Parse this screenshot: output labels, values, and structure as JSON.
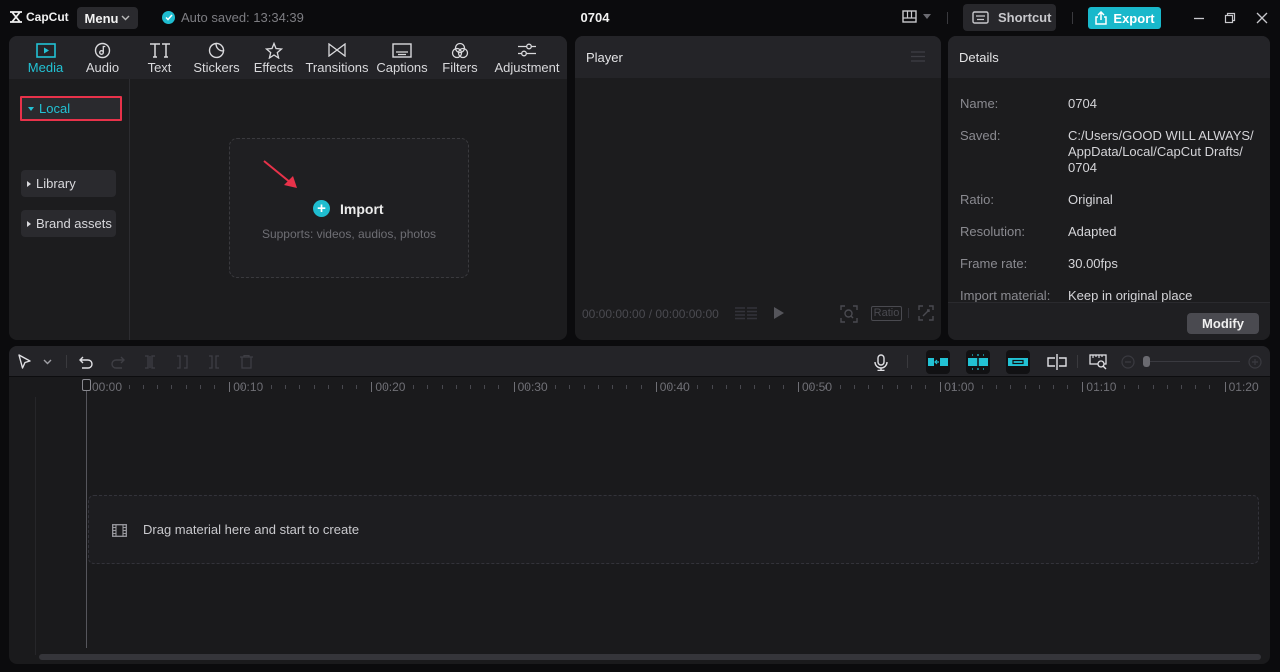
{
  "titlebar": {
    "app_name": "CapCut",
    "menu_label": "Menu",
    "autosave_text": "Auto saved: 13:34:39",
    "project_title": "0704",
    "shortcut_label": "Shortcut",
    "export_label": "Export",
    "accent_color": "#19b8cb"
  },
  "media_tabs": [
    {
      "label": "Media",
      "icon": "media-icon",
      "active": true
    },
    {
      "label": "Audio",
      "icon": "audio-icon",
      "active": false
    },
    {
      "label": "Text",
      "icon": "text-icon",
      "active": false
    },
    {
      "label": "Stickers",
      "icon": "stickers-icon",
      "active": false
    },
    {
      "label": "Effects",
      "icon": "effects-icon",
      "active": false
    },
    {
      "label": "Transitions",
      "icon": "transitions-icon",
      "active": false
    },
    {
      "label": "Captions",
      "icon": "captions-icon",
      "active": false
    },
    {
      "label": "Filters",
      "icon": "filters-icon",
      "active": false
    },
    {
      "label": "Adjustment",
      "icon": "adjustment-icon",
      "active": false
    }
  ],
  "media_sidebar": {
    "local": "Local",
    "import": "Import",
    "library": "Library",
    "brand_assets": "Brand assets"
  },
  "import_box": {
    "title": "Import",
    "subtitle": "Supports: videos, audios, photos"
  },
  "player": {
    "title": "Player",
    "timecode": "00:00:00:00 / 00:00:00:00",
    "ratio_label": "Ratio"
  },
  "details": {
    "title": "Details",
    "rows": [
      {
        "label": "Name:",
        "value": "0704"
      },
      {
        "label": "Saved:",
        "value_lines": [
          "C:/Users/GOOD WILL ALWAYS/",
          "AppData/Local/CapCut Drafts/",
          "0704"
        ]
      },
      {
        "label": "Ratio:",
        "value": "Original"
      },
      {
        "label": "Resolution:",
        "value": "Adapted"
      },
      {
        "label": "Frame rate:",
        "value": "30.00fps"
      },
      {
        "label": "Import material:",
        "value": "Keep in original place"
      }
    ],
    "modify_label": "Modify"
  },
  "timeline": {
    "ruler_labels": [
      "00:00",
      "00:10",
      "00:20",
      "00:30",
      "00:40",
      "00:50",
      "01:00",
      "01:10",
      "01:20"
    ],
    "drop_text": "Drag material here and start to create"
  }
}
